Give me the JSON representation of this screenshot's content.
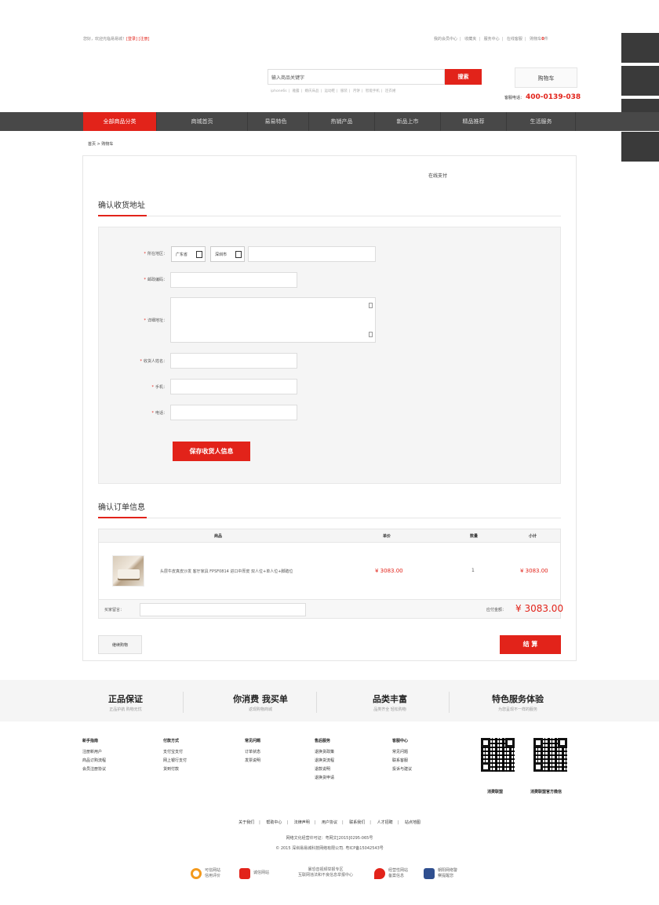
{
  "topbar": {
    "welcome": "您好，欢迎光临易易城！",
    "login": "[登录]",
    "register": "[注册]",
    "links": [
      "我的会员中心",
      "收藏夹",
      "服务中心",
      "在线客服"
    ],
    "cart_prefix": "购物车",
    "cart_count": "0",
    "cart_suffix": "件"
  },
  "search": {
    "placeholder": "输入商品关键字",
    "button": "搜索",
    "hotwords": [
      "iphone6s",
      "雅露",
      "婚庆床品",
      "运动鞋",
      "服装",
      "月饼",
      "智能手机",
      "连衣裙"
    ]
  },
  "cart_button": "购物车",
  "hotline": {
    "label": "客服电话：",
    "number": "400-0139-038"
  },
  "nav": [
    "全部商品分类",
    "商城首页",
    "易易特色",
    "热销产品",
    "新品上市",
    "精品推荐",
    "生活服务"
  ],
  "breadcrumb": "首页 > 购物车",
  "pay_online": "在线支付",
  "address": {
    "title": "确认收货地址",
    "region_label": "所在地区：",
    "province": "广东省",
    "city": "深圳市",
    "zip_label": "邮政编码：",
    "detail_label": "详细地址：",
    "name_label": "收货人姓名：",
    "mobile_label": "手机：",
    "phone_label": "电话：",
    "save": "保存收货人信息"
  },
  "order": {
    "title": "确认订单信息",
    "headers": [
      "商品",
      "单价",
      "数量",
      "小计"
    ],
    "item": {
      "name": "头层牛皮真皮沙发 客厅家具 FPSF0814 进口中厚皮 双人位+单人位+脚踏位",
      "price": "¥ 3083.00",
      "qty": "1",
      "subtotal": "¥ 3083.00"
    },
    "message_label": "买家留言：",
    "total_label": "应付金额：",
    "total": "¥ 3083.00",
    "continue": "继续购物",
    "checkout": "结 算"
  },
  "band": [
    {
      "title": "正品保证",
      "sub": "正品护航 购物无忧"
    },
    {
      "title": "你消费 我买单",
      "sub": "返现购物商城"
    },
    {
      "title": "品类丰富",
      "sub": "品类齐全 轻松购物"
    },
    {
      "title": "特色服务体验",
      "sub": "为您呈现不一样的服务"
    }
  ],
  "footer_cols": [
    {
      "head": "新手指南",
      "items": [
        "注册新用户",
        "商品订购流程",
        "会员注册协议"
      ]
    },
    {
      "head": "付款方式",
      "items": [
        "支付宝支付",
        "网上银行支付",
        "货到付款"
      ]
    },
    {
      "head": "常见问题",
      "items": [
        "订单状态",
        "发票说明"
      ]
    },
    {
      "head": "售后服务",
      "items": [
        "退换货政策",
        "退换货流程",
        "退款说明",
        "退换货申请"
      ]
    },
    {
      "head": "客服中心",
      "items": [
        "常见问题",
        "联系客服",
        "投诉与建议"
      ]
    }
  ],
  "qr_captions": [
    "消费联盟",
    "消费联盟官方微信"
  ],
  "foot_links": [
    "关于我们",
    "帮助中心",
    "法律声明",
    "用户协议",
    "联系我们",
    "人才招聘",
    "站点地图"
  ],
  "license": "网络文化经营许可证：粤网文[2015]0295-065号",
  "copyright": "© 2015 深圳易易城科技网络有限公司. 粤ICP备15042543号",
  "badges": [
    {
      "line1": "可信网站",
      "line2": "信用评价",
      "color": "#f39a1e"
    },
    {
      "line1": "诚信网站",
      "line2": "",
      "color": "#e2231a"
    },
    {
      "line1": "暴恐音视频举报专区",
      "line2": "互联网违法和不良信息举报中心",
      "color": "#ffffff"
    },
    {
      "line1": "经营性网站",
      "line2": "备案信息",
      "color": "#e2231a"
    },
    {
      "line1": "朝阳网络警",
      "line2": "察提醒您",
      "color": "#2f4f8f"
    }
  ]
}
